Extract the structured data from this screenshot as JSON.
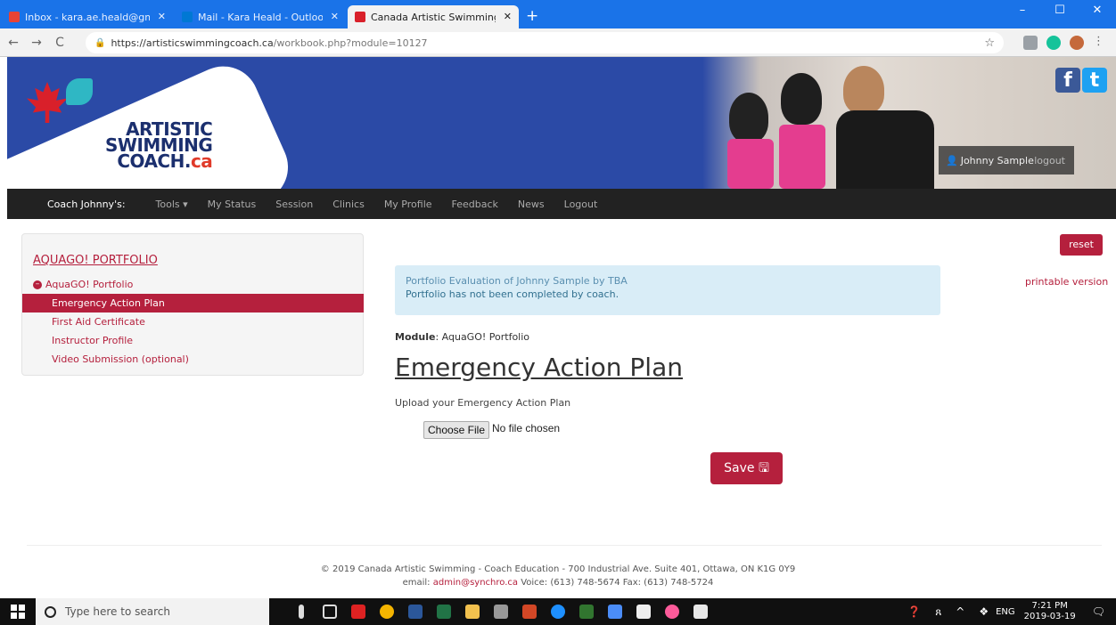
{
  "browser": {
    "tabs": [
      {
        "title": "Inbox - kara.ae.heald@gmail.com",
        "color": "#e84335"
      },
      {
        "title": "Mail - Kara Heald - Outlook",
        "color": "#0078d4"
      },
      {
        "title": "Canada Artistic Swimming Coach",
        "color": "#d9202a"
      }
    ],
    "url_host": "https://artisticswimmingcoach.ca",
    "url_path": "/workbook.php?module=10127"
  },
  "header": {
    "logo_line1": "ARTISTIC",
    "logo_line2": "SWIMMING",
    "logo_line3": "COACH.",
    "logo_ca": "ca",
    "user_name": "Johnny Sample",
    "logout_label": "logout"
  },
  "nav": {
    "brand": "Coach Johnny's:",
    "items": [
      "Tools ▾",
      "My Status",
      "Session",
      "Clinics",
      "My Profile",
      "Feedback",
      "News",
      "Logout"
    ]
  },
  "sidebar": {
    "title": "AQUAGO! PORTFOLIO",
    "group": "AquaGO! Portfolio",
    "items": [
      "Emergency Action Plan",
      "First Aid Certificate",
      "Instructor Profile",
      "Video Submission (optional)"
    ]
  },
  "main": {
    "reset_label": "reset",
    "printable_label": "printable version",
    "alert_line1": "Portfolio Evaluation of Johnny Sample by TBA",
    "alert_line2": "Portfolio has not been completed by coach.",
    "module_label": "Module",
    "module_value": ": AquaGO! Portfolio",
    "heading": "Emergency Action Plan",
    "upload_label": "Upload your Emergency Action Plan",
    "file_button": "Choose File",
    "file_status": "No file chosen",
    "save_label": "Save 🖫"
  },
  "footer": {
    "line1": "© 2019 Canada Artistic Swimming - Coach Education - 700 Industrial Ave. Suite 401, Ottawa, ON K1G 0Y9",
    "email_label": "email: ",
    "email": "admin@synchro.ca",
    "contact": " Voice: (613) 748-5674 Fax: (613) 748-5724"
  },
  "taskbar": {
    "search_placeholder": "Type here to search",
    "lang": "ENG",
    "time": "7:21 PM",
    "date": "2019-03-19"
  },
  "colors": {
    "accent": "#b5203d",
    "header_blue": "#2b4aa6",
    "alert_bg": "#d9edf7"
  }
}
